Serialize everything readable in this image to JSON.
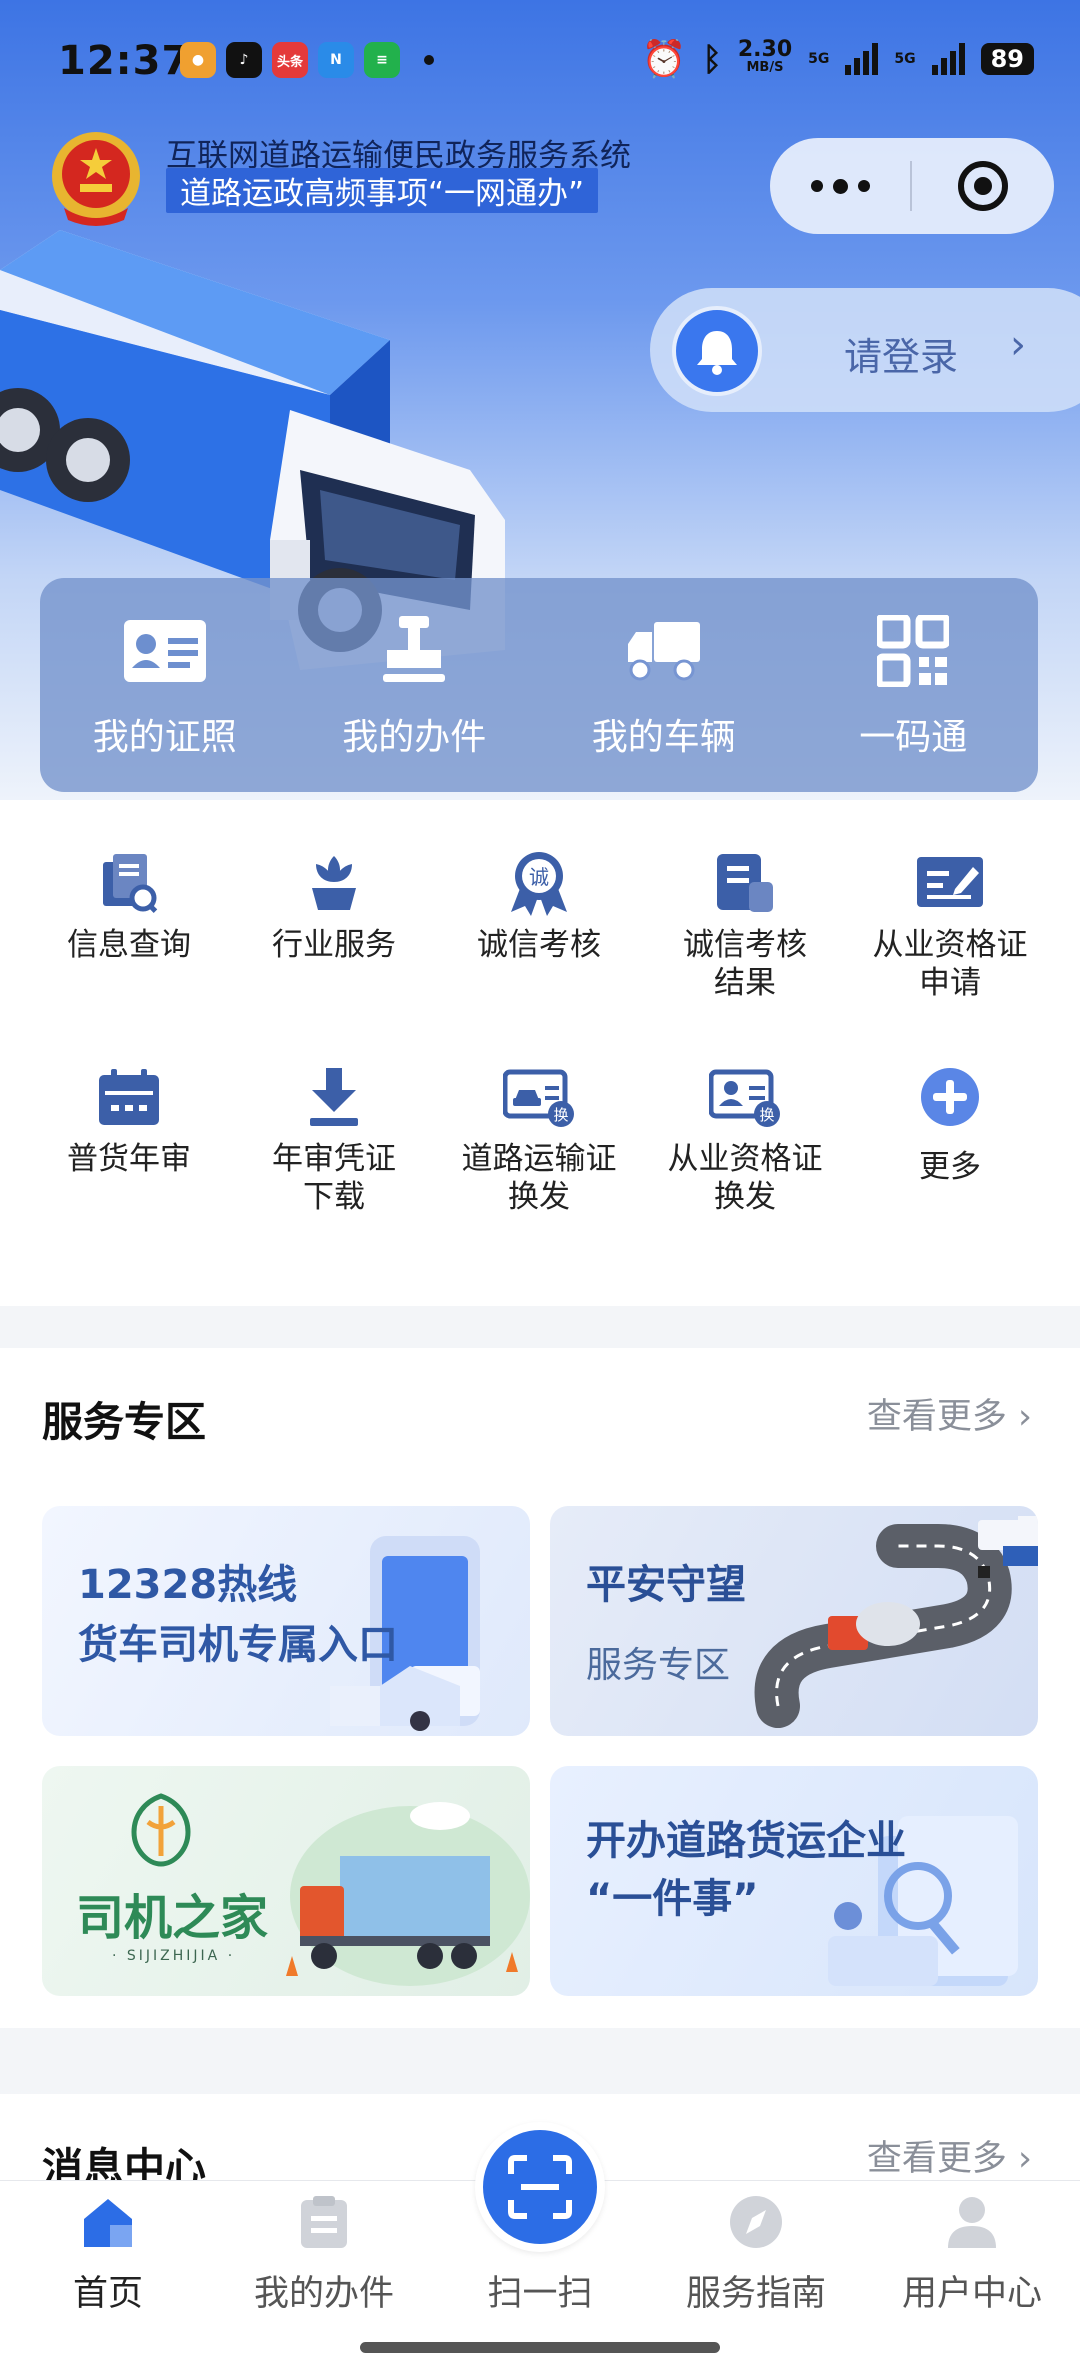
{
  "status_bar": {
    "time": "12:37",
    "app_icons": [
      "头条"
    ],
    "speed": "2.30",
    "speed_unit": "MB/S",
    "network1": "5G",
    "network2": "5G",
    "battery": "89"
  },
  "header": {
    "title_line1": "互联网道路运输便民政务服务系统",
    "title_line2": "道路运政高频事项“一网通办”"
  },
  "login": {
    "label": "请登录",
    "arrow": "›"
  },
  "quick_actions": [
    {
      "label": "我的证照",
      "icon": "id-card-icon"
    },
    {
      "label": "我的办件",
      "icon": "stamp-icon"
    },
    {
      "label": "我的车辆",
      "icon": "truck-icon"
    },
    {
      "label": "一码通",
      "icon": "qr-code-icon"
    }
  ],
  "services": [
    {
      "label": "信息查询",
      "icon": "info-search-icon"
    },
    {
      "label": "行业服务",
      "icon": "flower-icon"
    },
    {
      "label": "诚信考核",
      "icon": "credit-badge-icon",
      "badge": "诚"
    },
    {
      "label": "诚信考核\n结果",
      "icon": "document-icon"
    },
    {
      "label": "从业资格证\n申请",
      "icon": "certificate-edit-icon"
    },
    {
      "label": "普货年审",
      "icon": "calendar-icon"
    },
    {
      "label": "年审凭证\n下载",
      "icon": "download-icon"
    },
    {
      "label": "道路运输证\n换发",
      "icon": "vehicle-license-icon",
      "badge": "换"
    },
    {
      "label": "从业资格证\n换发",
      "icon": "worker-license-icon",
      "badge": "换"
    },
    {
      "label": "更多",
      "icon": "plus-icon"
    }
  ],
  "service_zone": {
    "title": "服务专区",
    "more": "查看更多",
    "cards": [
      {
        "line1": "12328热线",
        "line2": "货车司机专属入口"
      },
      {
        "line1": "平安守望",
        "line2": "服务专区"
      },
      {
        "line1": "司机之家",
        "line2": "· SIJIZHIJIA ·"
      },
      {
        "line1": "开办道路货运企业",
        "line2": "“一件事”"
      }
    ]
  },
  "message_center": {
    "title": "消息中心",
    "more": "查看更多"
  },
  "tabs": [
    {
      "label": "首页",
      "icon": "home-icon"
    },
    {
      "label": "我的办件",
      "icon": "clipboard-icon"
    },
    {
      "label": "扫一扫",
      "icon": "scan-icon"
    },
    {
      "label": "服务指南",
      "icon": "compass-icon"
    },
    {
      "label": "用户中心",
      "icon": "user-icon"
    }
  ],
  "colors": {
    "primary": "#2c6de6",
    "icon_blue": "#3c5fa8",
    "hero_top": "#3d74e4"
  }
}
